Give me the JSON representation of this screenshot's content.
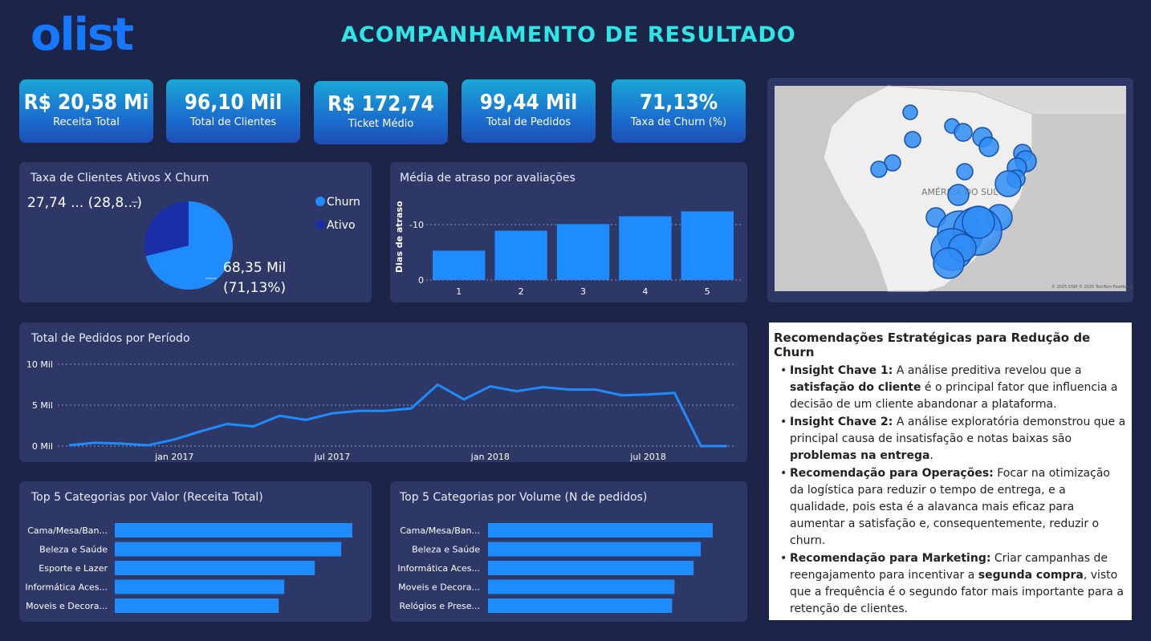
{
  "header": {
    "logo_text": "olist",
    "title": "ACOMPANHAMENTO  DE RESULTADO"
  },
  "kpis": [
    {
      "value": "R$ 20,58 Mi",
      "label": "Receita Total"
    },
    {
      "value": "96,10 Mil",
      "label": "Total de Clientes"
    },
    {
      "value": "R$ 172,74",
      "label": "Ticket Médio"
    },
    {
      "value": "99,44 Mil",
      "label": "Total de Pedidos"
    },
    {
      "value": "71,13%",
      "label": "Taxa de Churn (%)"
    }
  ],
  "pie_panel": {
    "title": "Taxa de Clientes Ativos X Churn",
    "label_small": "27,74 ... (28,8...)",
    "label_large_1": "68,35 Mil",
    "label_large_2": "(71,13%)",
    "legend": [
      {
        "name": "Churn",
        "color": "#1e8cff"
      },
      {
        "name": "Ativo",
        "color": "#1a2ea8"
      }
    ]
  },
  "delay_panel": {
    "title": "Média de atraso por avaliações",
    "ylabel": "Dias de atraso"
  },
  "orders_panel": {
    "title": "Total de Pedidos por Período"
  },
  "cat_value_panel": {
    "title": "Top 5 Categorias por Valor (Receita  Total)"
  },
  "cat_volume_panel": {
    "title": "Top 5 Categorias por Volume (N de pedidos)"
  },
  "map": {
    "label": "AMÉRICA DO SUL",
    "credits": "© 2025 OSM  © 2025 TomTom  Feedback"
  },
  "recommendations": {
    "title": "Recomendações Estratégicas para Redução de Churn",
    "items": [
      {
        "bold": "Insight Chave 1:",
        "text": " A análise preditiva revelou que a ",
        "bold2": "satisfação do cliente",
        "text2": " é o principal fator que influencia a decisão de um cliente abandonar a plataforma."
      },
      {
        "bold": "Insight Chave 2:",
        "text": " A análise exploratória demonstrou que a principal causa de insatisfação e notas baixas são ",
        "bold2": "problemas na entrega",
        "text2": "."
      },
      {
        "bold": "Recomendação para Operações:",
        "text": " Focar na otimização da logística para reduzir o tempo de entrega, e a qualidade, pois esta é a alavanca mais eficaz para aumentar a satisfação e, consequentemente, reduzir o churn.",
        "bold2": "",
        "text2": ""
      },
      {
        "bold": "Recomendação para Marketing:",
        "text": " Criar campanhas de reengajamento para incentivar a ",
        "bold2": "segunda compra",
        "text2": ", visto que a frequência é o segundo fator mais importante para a retenção de clientes."
      }
    ]
  },
  "chart_data": [
    {
      "type": "pie",
      "title": "Taxa de Clientes Ativos X Churn",
      "labels": [
        "Churn",
        "Ativo"
      ],
      "values": [
        68.35,
        27.74
      ],
      "percent": [
        71.13,
        28.87
      ],
      "colors": [
        "#1e8cff",
        "#1a2ea8"
      ],
      "legend": "right"
    },
    {
      "type": "bar",
      "title": "Média de atraso por avaliações",
      "ylabel": "Dias de atraso",
      "categories": [
        "1",
        "2",
        "3",
        "4",
        "5"
      ],
      "values": [
        -5.3,
        -8.9,
        -10.1,
        -11.5,
        -12.4
      ],
      "yticks": [
        "0",
        "-10"
      ],
      "ylim": [
        0,
        -13
      ],
      "color": "#1e8cff"
    },
    {
      "type": "line",
      "title": "Total de Pedidos por Período",
      "x": [
        "2016-09",
        "2016-10",
        "2016-11",
        "2016-12",
        "2017-01",
        "2017-02",
        "2017-03",
        "2017-04",
        "2017-05",
        "2017-06",
        "2017-07",
        "2017-08",
        "2017-09",
        "2017-10",
        "2017-11",
        "2017-12",
        "2018-01",
        "2018-02",
        "2018-03",
        "2018-04",
        "2018-05",
        "2018-06",
        "2018-07",
        "2018-08",
        "2018-09",
        "2018-10"
      ],
      "values": [
        0.1,
        0.4,
        0.3,
        0.1,
        0.8,
        1.8,
        2.7,
        2.4,
        3.7,
        3.2,
        4.0,
        4.3,
        4.3,
        4.6,
        7.5,
        5.7,
        7.3,
        6.7,
        7.2,
        6.9,
        6.9,
        6.2,
        6.3,
        6.5,
        0.0,
        0.0
      ],
      "xtick_labels": [
        "jan 2017",
        "jul 2017",
        "jan 2018",
        "jul 2018"
      ],
      "xtick_index": [
        4,
        10,
        16,
        22
      ],
      "yticks": [
        "0 Mil",
        "5 Mil",
        "10 Mil"
      ],
      "ylim": [
        0,
        10
      ],
      "grid": true,
      "color": "#1e8cff"
    },
    {
      "type": "bar",
      "orientation": "horizontal",
      "title": "Top 5 Categorias por Valor (Receita  Total)",
      "categories": [
        "Cama/Mesa/Ban...",
        "Beleza e Saúde",
        "Esporte e Lazer",
        "Informática Aces...",
        "Moveis e Decora..."
      ],
      "values": [
        1.71,
        1.63,
        1.44,
        1.22,
        1.18
      ],
      "color": "#1e8cff"
    },
    {
      "type": "bar",
      "orientation": "horizontal",
      "title": "Top 5 Categorias por Volume (N de pedidos)",
      "categories": [
        "Cama/Mesa/Ban...",
        "Beleza e Saúde",
        "Informática Aces...",
        "Moveis e Decora...",
        "Relógios e Prese..."
      ],
      "values": [
        9.4,
        8.9,
        8.6,
        7.8,
        7.7
      ],
      "color": "#1e8cff"
    }
  ]
}
